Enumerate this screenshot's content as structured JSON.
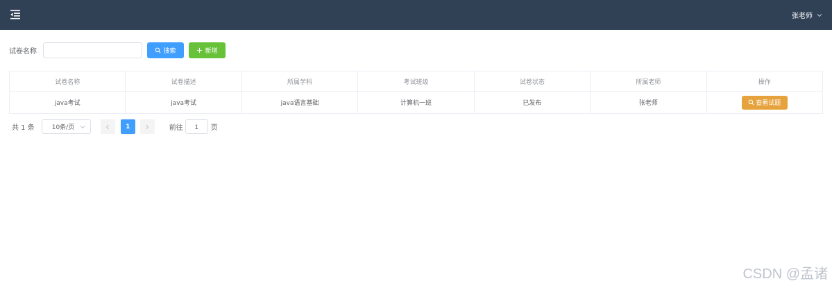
{
  "header": {
    "menu_icon": "hamburger-fold-icon",
    "user_name": "张老师",
    "user_icon": "chevron-down-icon"
  },
  "search": {
    "label": "试卷名称",
    "value": "",
    "placeholder": "",
    "search_button": "搜索",
    "add_button": "新增"
  },
  "table": {
    "columns": [
      "试卷名称",
      "试卷描述",
      "所属学科",
      "考试班级",
      "试卷状态",
      "所属老师",
      "操作"
    ],
    "rows": [
      {
        "name": "java考试",
        "description": "java考试",
        "subject": "java语言基础",
        "class": "计算机一班",
        "status": "已发布",
        "teacher": "张老师",
        "action": "查看试题"
      }
    ]
  },
  "pagination": {
    "total": "共 1 条",
    "page_size": "10条/页",
    "current_page": "1",
    "goto_label": "前往",
    "goto_value": "1",
    "page_suffix": "页"
  },
  "watermark": "CSDN @孟诸",
  "colors": {
    "topbar": "#304156",
    "primary": "#409eff",
    "success": "#67c23a",
    "warning": "#e6a23c"
  }
}
